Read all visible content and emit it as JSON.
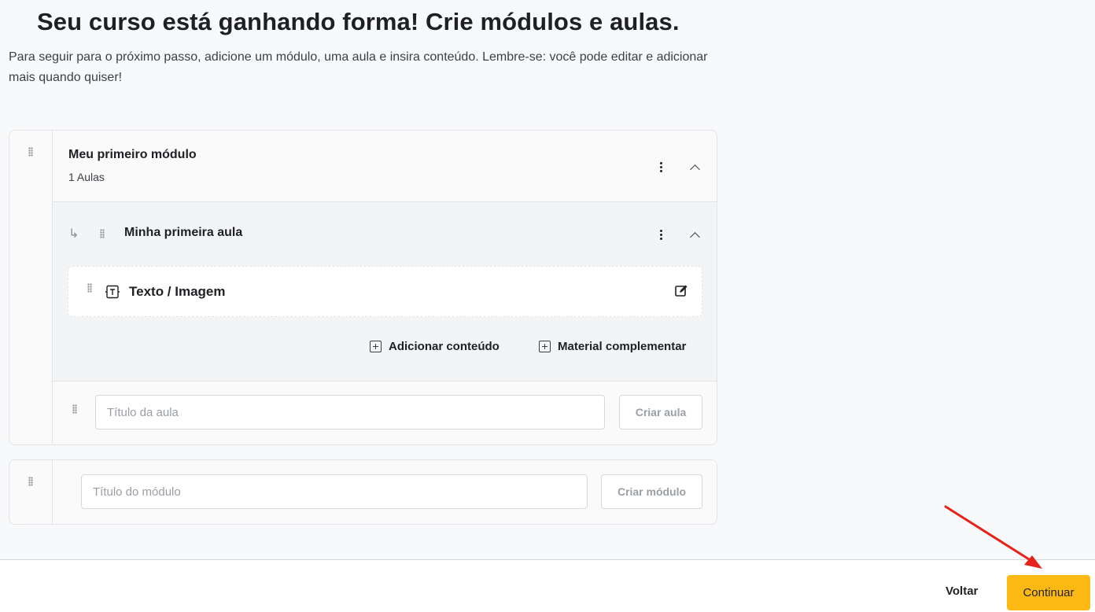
{
  "header": {
    "title": "Seu curso está ganhando forma! Crie módulos e aulas.",
    "subtitle": "Para seguir para o próximo passo, adicione um módulo, uma aula e insira conteúdo. Lembre-se: você pode editar e adicionar mais quando quiser!"
  },
  "module": {
    "title": "Meu primeiro módulo",
    "lesson_count": "1 Aulas",
    "lesson": {
      "title": "Minha primeira aula",
      "arrow": "↳",
      "content_item": {
        "label": "Texto / Imagem",
        "icon": "text-image-icon"
      },
      "add_content_label": "Adicionar conteúdo",
      "supplementary_label": "Material complementar"
    },
    "new_lesson": {
      "placeholder": "Título da aula",
      "button_label": "Criar aula"
    }
  },
  "new_module": {
    "placeholder": "Título do módulo",
    "button_label": "Criar módulo"
  },
  "footer": {
    "back_label": "Voltar",
    "continue_label": "Continuar"
  },
  "colors": {
    "accent": "#fdb913",
    "annotation_arrow": "#e5231b"
  }
}
